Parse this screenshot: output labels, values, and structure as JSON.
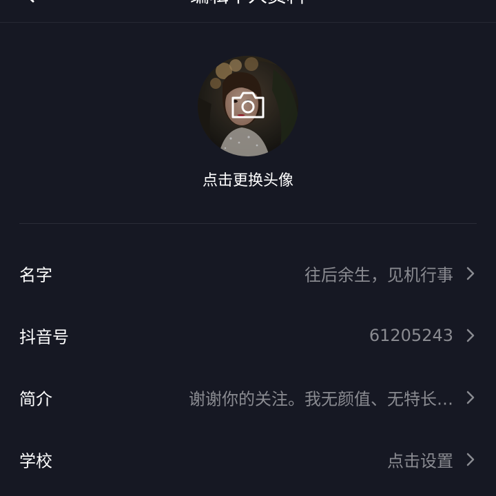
{
  "header": {
    "title": "编辑个人资料",
    "back_icon": "chevron-left-icon"
  },
  "avatar": {
    "camera_icon": "camera-icon",
    "change_label": "点击更换头像"
  },
  "profile_rows": [
    {
      "key": "name",
      "label": "名字",
      "value": "往后余生，见机行事"
    },
    {
      "key": "douyin-id",
      "label": "抖音号",
      "value": "61205243"
    },
    {
      "key": "bio",
      "label": "简介",
      "value": "谢谢你的关注。我无颜值、无特长…"
    },
    {
      "key": "school",
      "label": "学校",
      "value": "点击设置"
    }
  ],
  "colors": {
    "background": "#161823",
    "primary_text": "#ffffff",
    "secondary_text": "#8a8b91",
    "divider": "#2b2d38"
  }
}
